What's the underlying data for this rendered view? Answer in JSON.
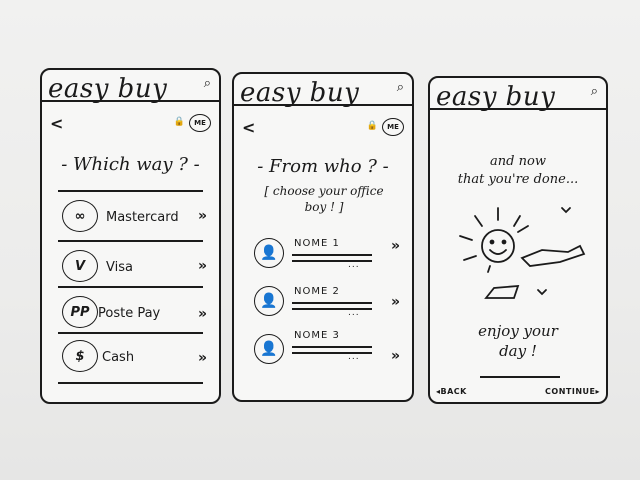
{
  "app": {
    "logo": "easy buy"
  },
  "screen1": {
    "back": "<",
    "lock": "🔒",
    "me": "ME",
    "title": "- Which way ? -",
    "methods": [
      {
        "label": "Mastercard",
        "icon": "∞"
      },
      {
        "label": "Visa",
        "icon": "V"
      },
      {
        "label": "Poste Pay",
        "icon": "PP"
      },
      {
        "label": "Cash",
        "icon": "$"
      }
    ],
    "chevron": "»"
  },
  "screen2": {
    "back": "<",
    "lock": "🔒",
    "me": "ME",
    "title": "- From who ? -",
    "subtitle": "[ choose your office boy ! ]",
    "people": [
      {
        "name": "NOME 1",
        "dots": "..."
      },
      {
        "name": "NOME 2",
        "dots": "..."
      },
      {
        "name": "NOME 3",
        "dots": "..."
      }
    ],
    "chevron": "»"
  },
  "screen3": {
    "line1": "and now",
    "line2": "that you're done...",
    "bottom1": "enjoy your",
    "bottom2": "day !",
    "back": "◂BACK",
    "continue": "CONTINUE▸"
  },
  "icons": {
    "search": "⌕",
    "sun_face": "☺",
    "bird": "⌄",
    "person": "👤"
  }
}
